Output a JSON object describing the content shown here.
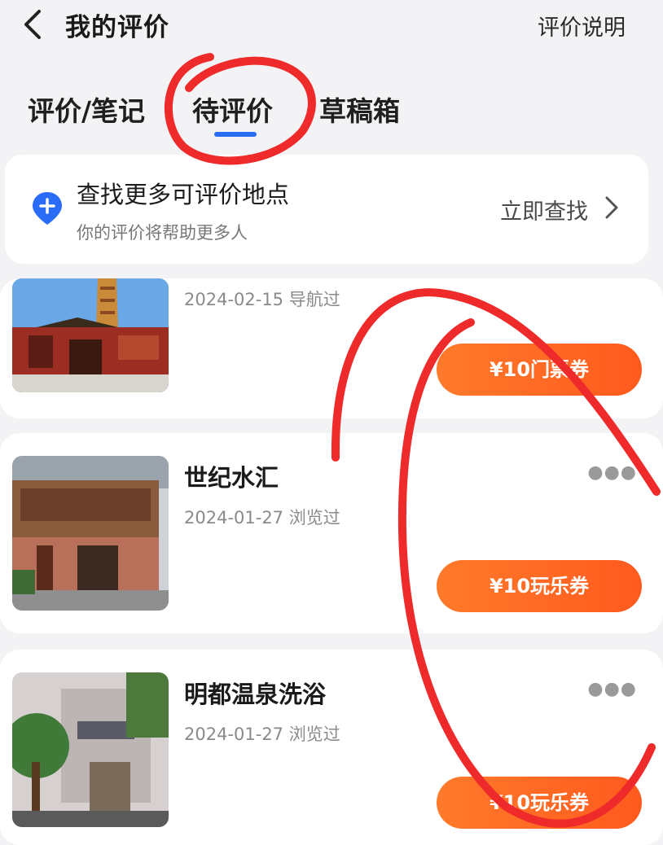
{
  "header": {
    "back_icon": "chevron-left-icon",
    "title": "我的评价",
    "help_link": "评价说明"
  },
  "tabs": [
    {
      "label": "评价/笔记",
      "active": false
    },
    {
      "label": "待评价",
      "active": true
    },
    {
      "label": "草稿箱",
      "active": false
    }
  ],
  "finder": {
    "icon": "location-plus-icon",
    "title": "查找更多可评价地点",
    "subtitle": "你的评价将帮助更多人",
    "action": "立即查找"
  },
  "items": [
    {
      "name": "",
      "meta": "2024-02-15 导航过",
      "coupon": "¥10门票券",
      "thumb_icon": "pagoda-photo"
    },
    {
      "name": "世纪水汇",
      "meta": "2024-01-27 浏览过",
      "coupon": "¥10玩乐券",
      "thumb_icon": "building-photo"
    },
    {
      "name": "明都温泉洗浴",
      "meta": "2024-01-27 浏览过",
      "coupon": "¥10玩乐券",
      "thumb_icon": "spa-building-photo"
    }
  ],
  "colors": {
    "accent": "#2b6cf6",
    "coupon": "#ff6a24",
    "annotation": "#ee2a2a"
  }
}
